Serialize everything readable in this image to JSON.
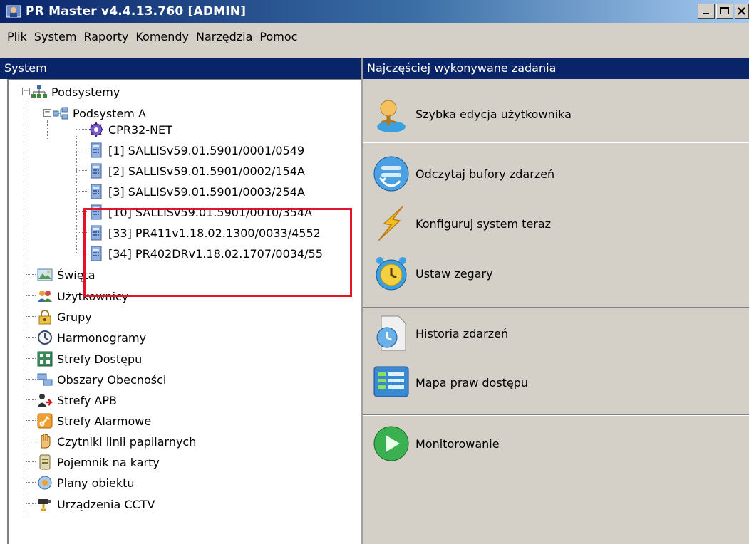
{
  "window": {
    "title": "PR Master v4.4.13.760 [ADMIN]"
  },
  "menu": [
    "Plik",
    "System",
    "Raporty",
    "Komendy",
    "Narzędzia",
    "Pomoc"
  ],
  "left_panel": {
    "header": "System",
    "tree": [
      {
        "label": "Podsystemy",
        "icon": "network-icon"
      },
      {
        "label": "Podsystem A",
        "icon": "subsystem-icon"
      },
      {
        "label": "CPR32-NET",
        "icon": "gear-icon"
      },
      {
        "label": "[1] SALLISv59.01.5901/0001/0549",
        "icon": "controller-icon"
      },
      {
        "label": "[2] SALLISv59.01.5901/0002/154A",
        "icon": "controller-icon"
      },
      {
        "label": "[3] SALLISv59.01.5901/0003/254A",
        "icon": "controller-icon"
      },
      {
        "label": "[10] SALLISv59.01.5901/0010/354A",
        "icon": "controller-icon"
      },
      {
        "label": "[33] PR411v1.18.02.1300/0033/4552",
        "icon": "controller-icon"
      },
      {
        "label": "[34] PR402DRv1.18.02.1707/0034/55",
        "icon": "controller-icon"
      },
      {
        "label": "Święta",
        "icon": "holiday-icon"
      },
      {
        "label": "Użytkownicy",
        "icon": "users-icon"
      },
      {
        "label": "Grupy",
        "icon": "lock-icon"
      },
      {
        "label": "Harmonogramy",
        "icon": "clock-icon"
      },
      {
        "label": "Strefy Dostępu",
        "icon": "zones-icon"
      },
      {
        "label": "Obszary Obecności",
        "icon": "areas-icon"
      },
      {
        "label": "Strefy APB",
        "icon": "apb-icon"
      },
      {
        "label": "Strefy Alarmowe",
        "icon": "alarm-icon"
      },
      {
        "label": "Czytniki linii papilarnych",
        "icon": "hand-icon"
      },
      {
        "label": "Pojemnik na karty",
        "icon": "card-box-icon"
      },
      {
        "label": "Plany obiektu",
        "icon": "plans-icon"
      },
      {
        "label": "Urządzenia CCTV",
        "icon": "cctv-icon"
      }
    ]
  },
  "right_panel": {
    "header": "Najczęściej wykonywane zadania",
    "tasks": [
      {
        "label": "Szybka edycja użytkownika",
        "icon": "user-edit-icon"
      },
      {
        "label": "Odczytaj bufory zdarzeń",
        "icon": "read-buffer-icon"
      },
      {
        "label": "Konfiguruj system teraz",
        "icon": "lightning-icon"
      },
      {
        "label": "Ustaw zegary",
        "icon": "alarm-clock-icon"
      },
      {
        "label": "Historia zdarzeń",
        "icon": "history-icon"
      },
      {
        "label": "Mapa praw dostępu",
        "icon": "access-map-icon"
      },
      {
        "label": "Monitorowanie",
        "icon": "monitor-play-icon"
      }
    ]
  },
  "colors": {
    "titlebar": "#0a246a",
    "header": "#0a246a",
    "highlight": "#e2142b",
    "face": "#d4d0c8"
  }
}
